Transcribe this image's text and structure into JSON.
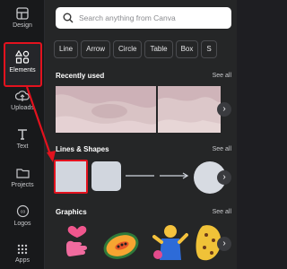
{
  "sidebar": {
    "items": [
      {
        "label": "Design"
      },
      {
        "label": "Elements"
      },
      {
        "label": "Uploads"
      },
      {
        "label": "Text"
      },
      {
        "label": "Projects"
      },
      {
        "label": "Logos"
      },
      {
        "label": "Apps"
      }
    ]
  },
  "search": {
    "placeholder": "Search anything from Canva"
  },
  "chips": [
    "Line",
    "Arrow",
    "Circle",
    "Table",
    "Box",
    "S"
  ],
  "sections": {
    "recently_used": {
      "title": "Recently used",
      "see_all": "See all"
    },
    "lines_shapes": {
      "title": "Lines & Shapes",
      "see_all": "See all"
    },
    "graphics": {
      "title": "Graphics",
      "see_all": "See all"
    }
  },
  "colors": {
    "highlight": "#e3121e",
    "accent": "#8b3dff"
  }
}
